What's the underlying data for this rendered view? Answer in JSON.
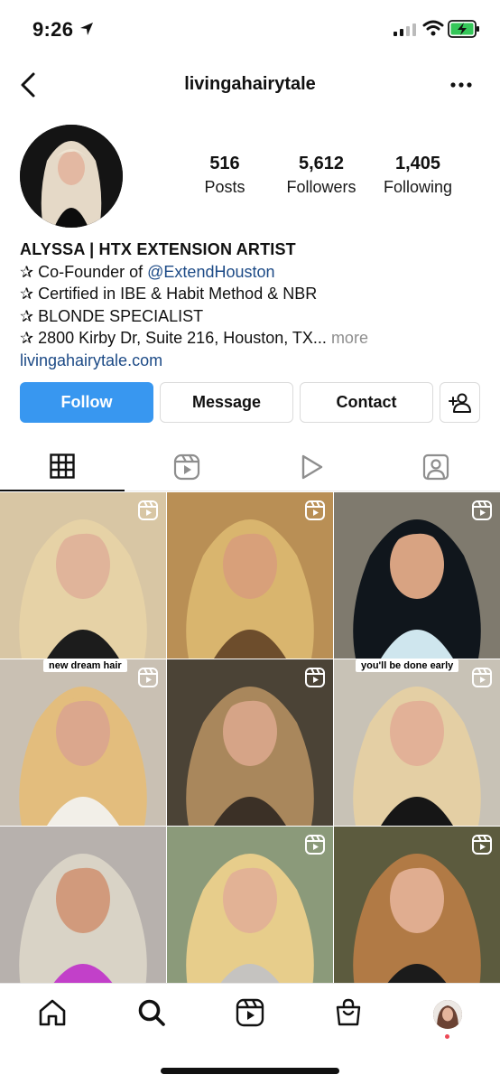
{
  "status_bar": {
    "time": "9:26"
  },
  "header": {
    "username": "livingahairytale"
  },
  "profile": {
    "stats": [
      {
        "value": "516",
        "label": "Posts"
      },
      {
        "value": "5,612",
        "label": "Followers"
      },
      {
        "value": "1,405",
        "label": "Following"
      }
    ],
    "bio": {
      "name": "ALYSSA | HTX EXTENSION ARTIST",
      "line1_prefix": "✰ Co-Founder of ",
      "line1_mention": "@ExtendHouston",
      "line2": "✰ Certified in IBE & Habit Method & NBR",
      "line3": "✰ BLONDE SPECIALIST",
      "line4": "✰ 2800 Kirby Dr, Suite 216, Houston, TX...",
      "more": " more",
      "link": "livingahairytale.com"
    }
  },
  "actions": {
    "follow": "Follow",
    "message": "Message",
    "contact": "Contact"
  },
  "tabs": [
    "grid-icon",
    "reels-icon",
    "video-play-icon",
    "tagged-icon"
  ],
  "grid": {
    "posts": [
      {
        "caption": "",
        "reel": true,
        "bg": "#d8c6a4",
        "hair": "#e6d2a6",
        "face": "#e0b49a",
        "top": "#1c1c1c"
      },
      {
        "caption": "",
        "reel": true,
        "bg": "#b98f55",
        "hair": "#d9b56e",
        "face": "#d8a07a",
        "top": "#6d4d2c"
      },
      {
        "caption": "",
        "reel": true,
        "bg": "#7f7a6e",
        "hair": "#10161c",
        "face": "#d8a382",
        "top": "#cfe6ee"
      },
      {
        "caption": "new dream hair",
        "reel": true,
        "bg": "#c9c0b3",
        "hair": "#e3bd7d",
        "face": "#dba78d",
        "top": "#f2efe8"
      },
      {
        "caption": "",
        "reel": true,
        "bg": "#4b4336",
        "hair": "#a9875c",
        "face": "#d6a487",
        "top": "#3b3026"
      },
      {
        "caption": "you'll be done early",
        "reel": true,
        "bg": "#c8c2b6",
        "hair": "#e4cfa4",
        "face": "#e2b197",
        "top": "#161616"
      },
      {
        "caption": "",
        "reel": false,
        "bg": "#b7b1ad",
        "hair": "#d9d3c6",
        "face": "#d19a7c",
        "top": "#c240c9"
      },
      {
        "caption": "",
        "reel": true,
        "bg": "#8b9a7a",
        "hair": "#e7cd8b",
        "face": "#e2b295",
        "top": "#c5c3c0"
      },
      {
        "caption": "",
        "reel": true,
        "bg": "#5c5b3e",
        "hair": "#b17a45",
        "face": "#e0ad90",
        "top": "#1b1b1b"
      }
    ]
  },
  "bottom_nav": [
    "home-icon",
    "search-icon",
    "reels-icon",
    "shop-icon",
    "profile-avatar"
  ]
}
